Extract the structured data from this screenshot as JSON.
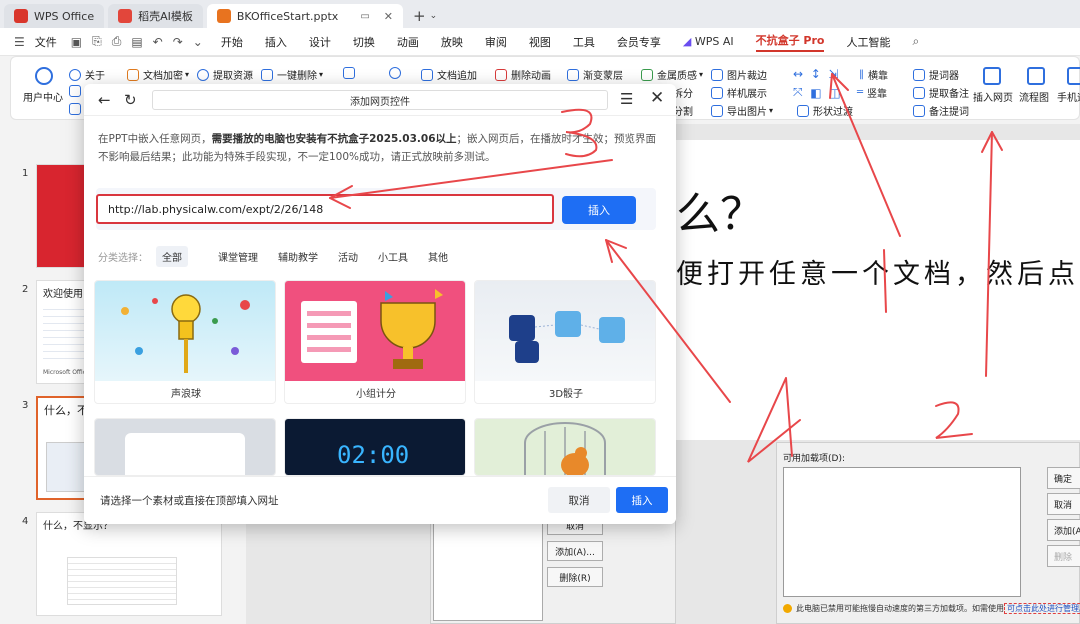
{
  "titlebar": {
    "tabs": [
      {
        "label": "WPS Office",
        "color": "#d9362b"
      },
      {
        "label": "稻壳AI模板",
        "color": "#e2463b"
      },
      {
        "label": "BKOfficeStart.pptx",
        "color": "#e8731f"
      }
    ],
    "add": "+"
  },
  "menubar": {
    "file": "文件",
    "items": [
      "开始",
      "插入",
      "设计",
      "切换",
      "动画",
      "放映",
      "审阅",
      "视图",
      "工具",
      "会员专享"
    ],
    "wps_ai": "WPS AI",
    "pro_tab": "不抗盒子 Pro",
    "ai_tab": "人工智能"
  },
  "ribbon": {
    "user_center": "用户中心",
    "about": "关于",
    "doc_encrypt": "文档加密",
    "extract_res": "提取资源",
    "one_click_delete": "一键删除",
    "doc_append": "文档追加",
    "delete_anim": "删除动画",
    "gradient_mask": "渐变蒙层",
    "metal_texture": "金属质感",
    "image_crop": "图片裁边",
    "split": "拆分",
    "sample_show": "样机展示",
    "split2": "分割",
    "export_image": "导出图片",
    "shape_transition": "形状过渡",
    "align_horizontal": "横靠",
    "align_vertical": "竖靠",
    "teleprompter": "提词器",
    "extract_notes": "提取备注",
    "notes_prompt": "备注提词",
    "insert_webpage": "插入网页",
    "flowchart": "流程图",
    "mobile": "手机遥"
  },
  "slides": {
    "nums": [
      "1",
      "2",
      "3",
      "4"
    ],
    "thumb2_title": "欢迎使用",
    "thumb2_sub": "Microsoft Office",
    "thumb3_title": "什么，不",
    "thumb4_title": "什么，不显示？"
  },
  "canvas": {
    "big_question": "么？",
    "big_text": "便打开任意一个文档，然后点"
  },
  "bg_dialog": {
    "label": "可用加载项(D):",
    "buttons": [
      "确定",
      "取消",
      "添加(A)",
      "删除"
    ],
    "warning": "此电脑已禁用可能拖慢自动速度的第三方加载项。如需使用",
    "warning_link": "可点击此处进行管理。"
  },
  "mid_dialog": {
    "buttons": [
      "取消",
      "添加(A)...",
      "删除(R)"
    ]
  },
  "modal": {
    "title": "添加网页控件",
    "desc_1": "在PPT中嵌入任意网页，",
    "desc_bold": "需要播放的电脑也安装有不抗盒子2025.03.06以上",
    "desc_2": "；嵌入网页后，在播放时才生效；预览界面不影响最后结果；此功能为特殊手段实现，不一定100%成功，请正式放映前多测试。",
    "url_value": "http://lab.physicalw.com/expt/2/26/148",
    "insert_label": "插入",
    "category_label": "分类选择：",
    "categories": [
      "全部",
      "课堂管理",
      "辅助教学",
      "活动",
      "小工具",
      "其他"
    ],
    "cards": [
      {
        "caption": "声浪球"
      },
      {
        "caption": "小组计分"
      },
      {
        "caption": "3D骰子"
      },
      {
        "caption": ""
      },
      {
        "caption": "",
        "timer": "02:00"
      },
      {
        "caption": ""
      }
    ],
    "footer_hint": "请选择一个素材或直接在顶部填入网址",
    "cancel_label": "取消",
    "ok_label": "插入"
  },
  "annotations": {
    "labels": [
      "1",
      "2",
      "3",
      "4"
    ],
    "color": "#e8474a"
  }
}
